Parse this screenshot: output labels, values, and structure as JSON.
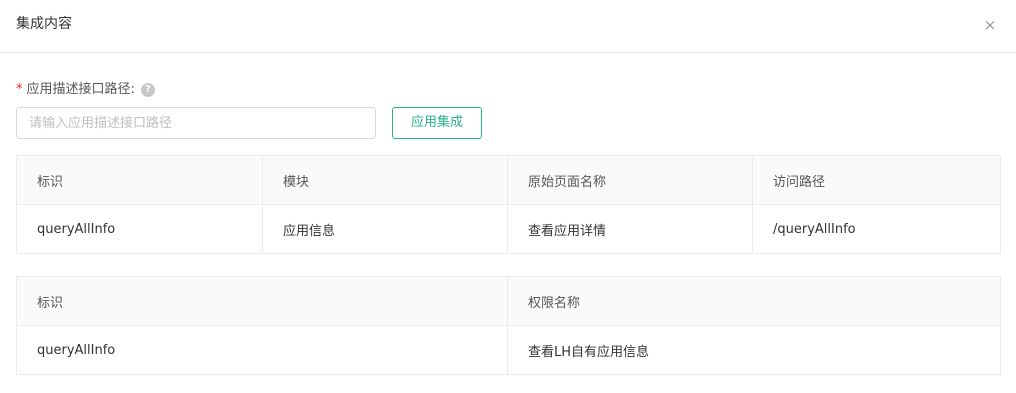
{
  "modal": {
    "title": "集成内容",
    "close_symbol": "×"
  },
  "form": {
    "required_mark": "*",
    "label": "应用描述接口路径:",
    "help_symbol": "?",
    "placeholder": "请输入应用描述接口路径",
    "value": "",
    "submit_label": "应用集成"
  },
  "page_table": {
    "headers": [
      "标识",
      "模块",
      "原始页面名称",
      "访问路径"
    ],
    "rows": [
      [
        "queryAllInfo",
        "应用信息",
        "查看应用详情",
        "/queryAllInfo"
      ]
    ]
  },
  "permission_table": {
    "headers": [
      "标识",
      "权限名称"
    ],
    "rows": [
      [
        "queryAllInfo",
        "查看LH自有应用信息"
      ]
    ]
  },
  "colors": {
    "accent": "#2bb28a",
    "required": "#f5222d",
    "border": "#ebebeb",
    "header_bg": "#fafafa"
  },
  "icons": {
    "close": "close-icon",
    "help": "question-circle-icon"
  }
}
